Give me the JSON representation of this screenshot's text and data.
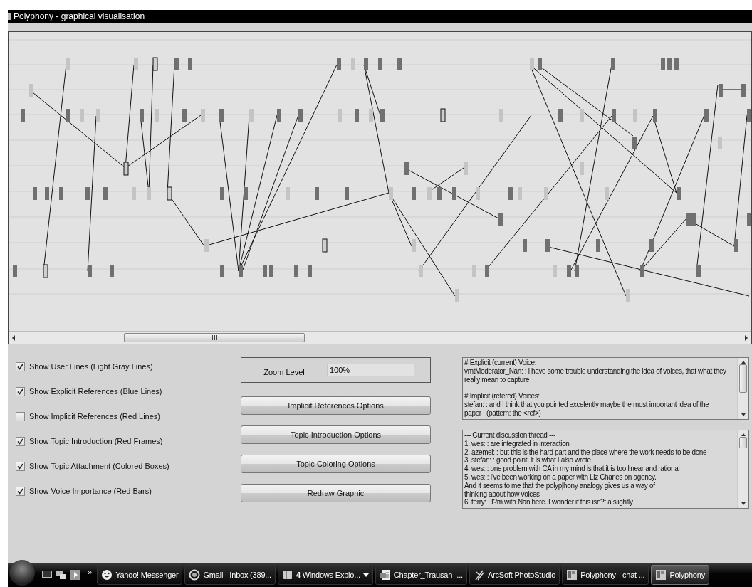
{
  "window": {
    "title": "Polyphony - graphical visualisation"
  },
  "options": [
    {
      "label": "Show User Lines (Light Gray Lines)",
      "checked": true
    },
    {
      "label": "Show Explicit References (Blue Lines)",
      "checked": true
    },
    {
      "label": "Show Implicit References (Red Lines)",
      "checked": false
    },
    {
      "label": "Show Topic Introduction (Red Frames)",
      "checked": true
    },
    {
      "label": "Show Topic Attachment (Colored Boxes)",
      "checked": true
    },
    {
      "label": "Show Voice Importance (Red Bars)",
      "checked": true
    }
  ],
  "zoom": {
    "label": "Zoom Level",
    "value": "100%"
  },
  "buttons": [
    "Implicit References Options",
    "Topic Introduction Options",
    "Topic Coloring Options",
    "Redraw Graphic"
  ],
  "voice_pane": {
    "sections": [
      {
        "lines": [
          "# Explicit (current) Voice:",
          "vmtModerator_Nan: : i have some trouble understanding the idea of voices, that what they",
          "really mean to capture"
        ]
      },
      {
        "lines": [
          "# Implicit (refered) Voices:",
          "stefan: : and I think that you pointed excelently maybe the most important idea of the",
          "paper   (pattern: the <ref>)"
        ]
      }
    ]
  },
  "thread_pane": {
    "sections": [
      {
        "lines": [
          "--- Current discussion thread ---",
          "1. wes: : are integrated in interaction",
          "2. azemel: : but this is the hard part and the place where the work needs to be done",
          "3. stefan: : good point, it is what I also wrote",
          "4. wes: : one problem with CA in my mind is that it is too linear and rational",
          "5. wes: : I've been working on a paper with Liz Charles on agency.",
          "And it seems to me that the polyp|hony analogy gives us a way of",
          "thinking about how voices",
          "6. terry: : I?m with Nan here. I wonder if this isn?t a slightly"
        ]
      }
    ]
  },
  "taskbar": {
    "overflow": "»",
    "items": [
      {
        "label": "Yahoo! Messenger",
        "kind": "smiley",
        "selected": false
      },
      {
        "label": "Gmail - Inbox (389...",
        "kind": "browser",
        "selected": false
      },
      {
        "label": "**4** Windows Explo...",
        "kind": "folder",
        "selected": false
      },
      {
        "label": "Chapter_Trausan -...",
        "kind": "document",
        "selected": false
      },
      {
        "label": "ArcSoft PhotoStudio",
        "kind": "pen",
        "selected": false
      },
      {
        "label": "Polyphony - chat ...",
        "kind": "app",
        "selected": false
      },
      {
        "label": "Polyphony",
        "kind": "app",
        "selected": true
      }
    ]
  }
}
